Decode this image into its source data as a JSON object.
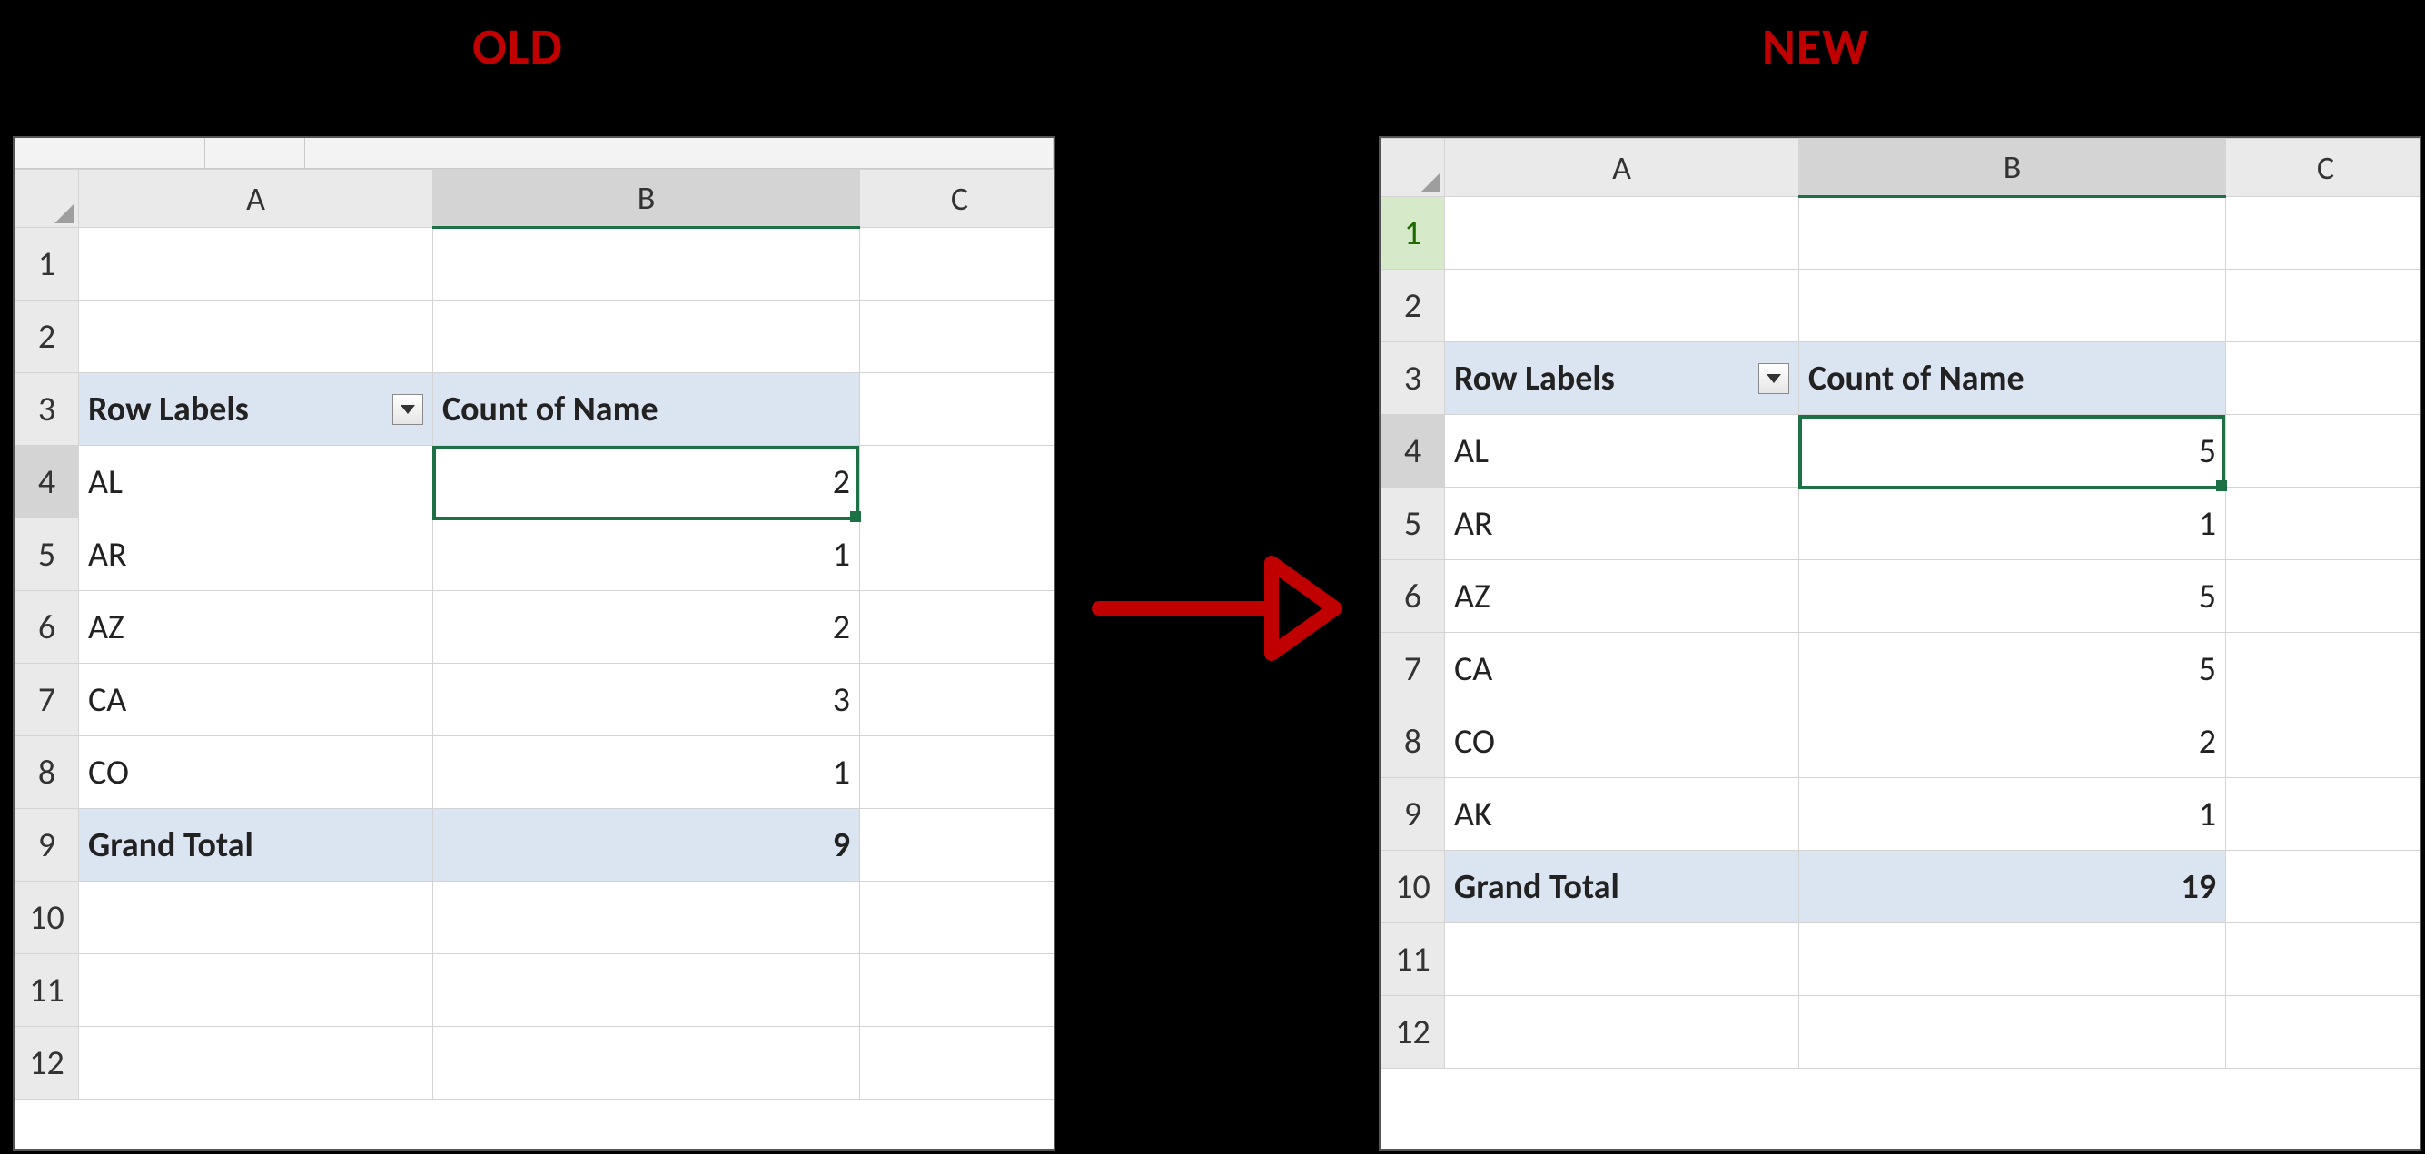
{
  "labels": {
    "old": "OLD",
    "new": "NEW"
  },
  "columns": [
    "A",
    "B",
    "C"
  ],
  "pivot_header": {
    "row_labels": "Row Labels",
    "count_col": "Count of Name"
  },
  "grand_total_label": "Grand Total",
  "old": {
    "row_numbers": [
      "1",
      "2",
      "3",
      "4",
      "5",
      "6",
      "7",
      "8",
      "9",
      "10",
      "11",
      "12"
    ],
    "rows": [
      {
        "label": "AL",
        "value": "2"
      },
      {
        "label": "AR",
        "value": "1"
      },
      {
        "label": "AZ",
        "value": "2"
      },
      {
        "label": "CA",
        "value": "3"
      },
      {
        "label": "CO",
        "value": "1"
      }
    ],
    "grand_total": "9",
    "active_cell": "B4"
  },
  "new": {
    "row_numbers": [
      "1",
      "2",
      "3",
      "4",
      "5",
      "6",
      "7",
      "8",
      "9",
      "10",
      "11",
      "12"
    ],
    "rows": [
      {
        "label": "AL",
        "value": "5"
      },
      {
        "label": "AR",
        "value": "1"
      },
      {
        "label": "AZ",
        "value": "5"
      },
      {
        "label": "CA",
        "value": "5"
      },
      {
        "label": "CO",
        "value": "2"
      },
      {
        "label": "AK",
        "value": "1"
      }
    ],
    "grand_total": "19",
    "active_cell": "B4"
  }
}
